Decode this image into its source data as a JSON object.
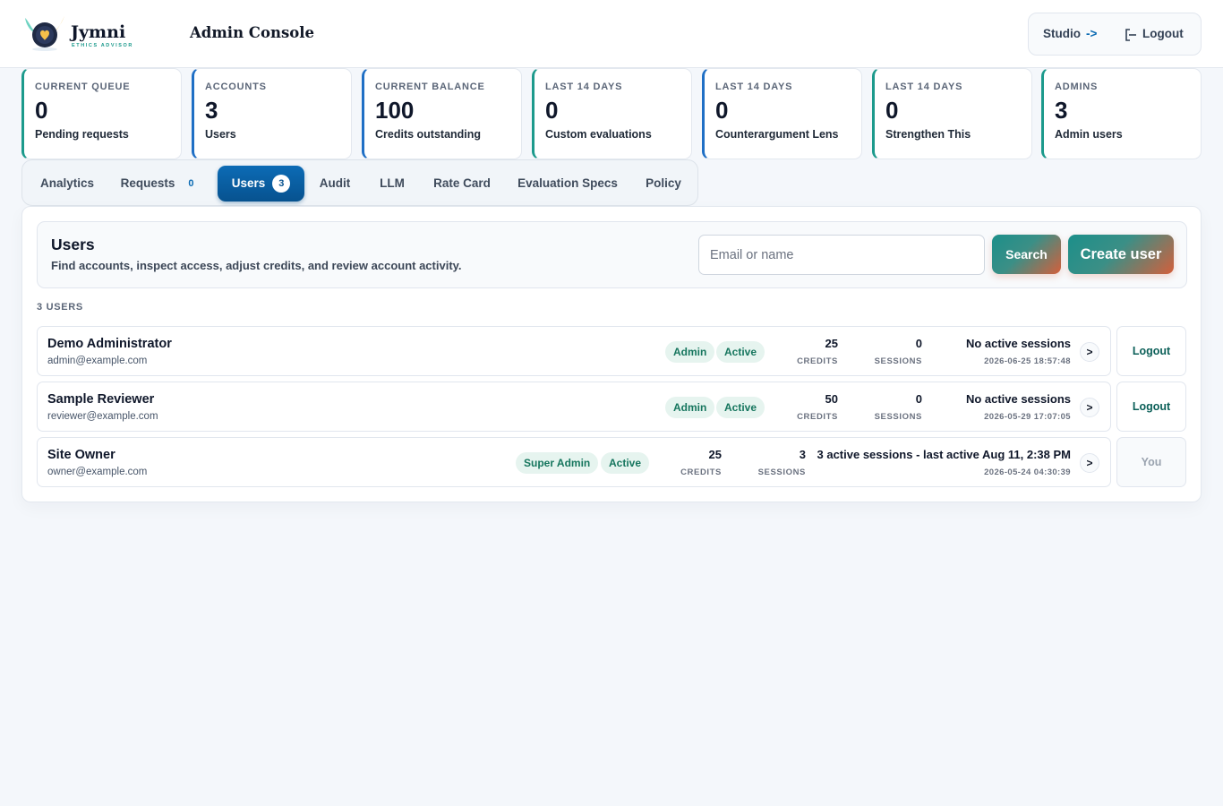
{
  "brand": {
    "name": "Jymni",
    "tagline": "ETHICS ADVISOR",
    "console_title": "Admin Console",
    "colors": {
      "teal": "#1c9a8c",
      "blue": "#0b6bb3",
      "orange": "#d45f3b"
    }
  },
  "header": {
    "studio_label": "Studio",
    "studio_arrow": "->",
    "logout_label": "Logout",
    "logout_icon": "logout-icon"
  },
  "stats": [
    {
      "label": "CURRENT QUEUE",
      "value": "0",
      "sub": "Pending requests"
    },
    {
      "label": "ACCOUNTS",
      "value": "3",
      "sub": "Users"
    },
    {
      "label": "CURRENT BALANCE",
      "value": "100",
      "sub": "Credits outstanding"
    },
    {
      "label": "LAST 14 DAYS",
      "value": "0",
      "sub": "Custom evaluations"
    },
    {
      "label": "LAST 14 DAYS",
      "value": "0",
      "sub": "Counterargument Lens"
    },
    {
      "label": "LAST 14 DAYS",
      "value": "0",
      "sub": "Strengthen This"
    },
    {
      "label": "ADMINS",
      "value": "3",
      "sub": "Admin users"
    }
  ],
  "tabs": [
    {
      "label": "Analytics"
    },
    {
      "label": "Requests",
      "count": "0"
    },
    {
      "label": "Users",
      "count": "3",
      "active": true
    },
    {
      "label": "Audit"
    },
    {
      "label": "LLM"
    },
    {
      "label": "Rate Card"
    },
    {
      "label": "Evaluation Specs"
    },
    {
      "label": "Policy"
    }
  ],
  "users_panel": {
    "title": "Users",
    "description": "Find accounts, inspect access, adjust credits, and review account activity.",
    "search_placeholder": "Email or name",
    "search_value": "",
    "search_label": "Search",
    "create_label": "Create user",
    "count_label": "3 USERS",
    "credits_label": "CREDITS",
    "sessions_label": "SESSIONS",
    "chevron": ">"
  },
  "users": [
    {
      "name": "Demo Administrator",
      "email": "admin@example.com",
      "badges": [
        "Admin",
        "Active"
      ],
      "credits": "25",
      "sessions": "0",
      "session_status": "No active sessions",
      "timestamp": "2026-06-25 18:57:48",
      "action": "Logout"
    },
    {
      "name": "Sample Reviewer",
      "email": "reviewer@example.com",
      "badges": [
        "Admin",
        "Active"
      ],
      "credits": "50",
      "sessions": "0",
      "session_status": "No active sessions",
      "timestamp": "2026-05-29 17:07:05",
      "action": "Logout"
    },
    {
      "name": "Site Owner",
      "email": "owner@example.com",
      "badges": [
        "Super Admin",
        "Active"
      ],
      "credits": "25",
      "sessions": "3",
      "session_status": "3 active sessions - last active Aug 11, 2:38 PM",
      "timestamp": "2026-05-24 04:30:39",
      "action": "You"
    }
  ]
}
